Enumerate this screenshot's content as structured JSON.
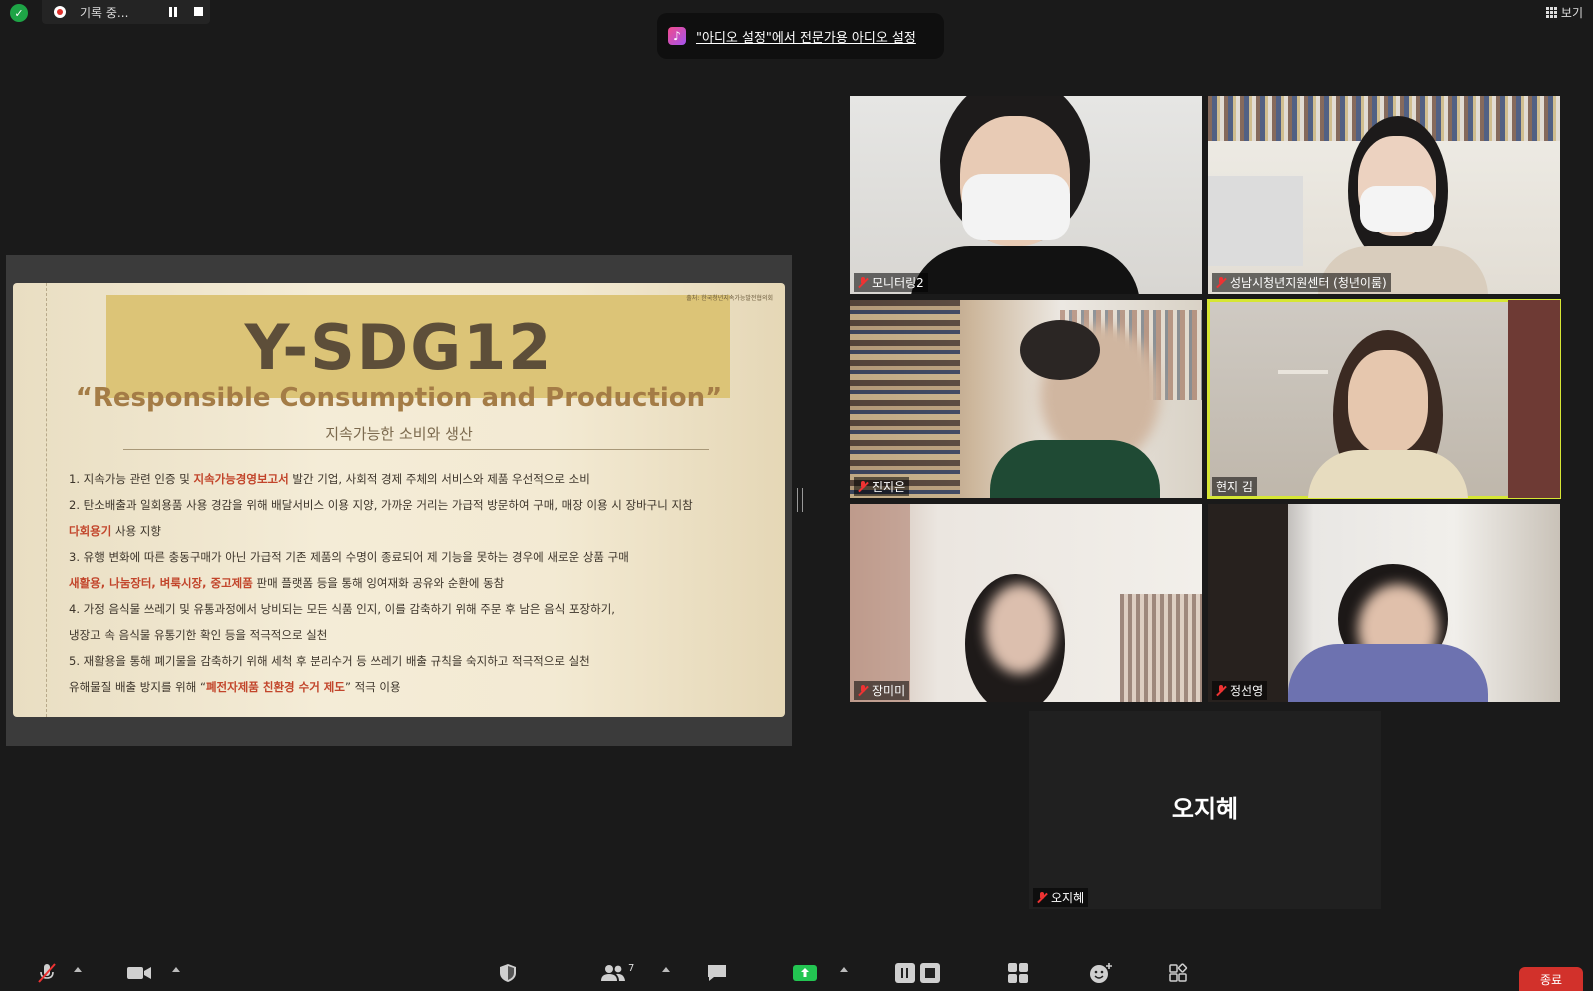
{
  "top_bar": {
    "recording_label": "기록 중...",
    "view_label": "보기"
  },
  "audio_toast": {
    "text": "\"아디오 설정\"에서 전문가용 아디오 설정"
  },
  "slide": {
    "source": "출처: 한국청년지속가능발전협의회",
    "title": "Y-SDG12",
    "subtitle": "“Responsible Consumption and Production”",
    "korean_subtitle": "지속가능한 소비와 생산",
    "lines": [
      {
        "pre": "1. 지속가능 관련 인증 및 ",
        "hl": "지속가능경영보고서",
        "post": " 발간 기업, 사회적 경제 주체의 서비스와 제품 우선적으로 소비"
      },
      {
        "pre": "2. 탄소배출과 일회용품 사용 경감을 위해 배달서비스 이용 지양, 가까운 거리는 가급적 방문하여 구매, 매장 이용 시 장바구니 지참",
        "hl": "",
        "post": ""
      },
      {
        "pre": "",
        "hl": "다회용기",
        "post": " 사용 지향"
      },
      {
        "pre": "3. 유행 변화에 따른 충동구매가 아닌 가급적 기존 제품의 수명이 종료되어 제 기능을 못하는 경우에 새로운 상품 구매",
        "hl": "",
        "post": ""
      },
      {
        "pre": "",
        "hl": "새활용, 나눔장터, 벼룩시장, 중고제품",
        "post": " 판매 플랫폼 등을 통해 잉여재화 공유와 순환에 동참"
      },
      {
        "pre": "4. 가정 음식물 쓰레기 및 유통과정에서 낭비되는 모든 식품 인지, 이를 감축하기 위해 주문 후 남은 음식 포장하기,",
        "hl": "",
        "post": ""
      },
      {
        "pre": "냉장고 속 음식물 유통기한 확인 등을 적극적으로 실천",
        "hl": "",
        "post": ""
      },
      {
        "pre": "5. 재활용을 통해 폐기물을 감축하기 위해 세척 후 분리수거 등 쓰레기 배출 규칙을 숙지하고 적극적으로 실천",
        "hl": "",
        "post": ""
      },
      {
        "pre": "유해물질 배출 방지를 위해 “",
        "hl": "폐전자제품 친환경 수거 제도",
        "post": "” 적극 이용"
      }
    ]
  },
  "participants": [
    {
      "name": "모니터링2",
      "muted": true
    },
    {
      "name": "성남시청년지원센터 (청년이룸)",
      "muted": true
    },
    {
      "name": "진지은",
      "muted": true
    },
    {
      "name": "현지 김",
      "muted": false,
      "active_speaker": true
    },
    {
      "name": "장미미",
      "muted": true
    },
    {
      "name": "정선영",
      "muted": true
    },
    {
      "name": "오지혜",
      "muted": true,
      "video_off": true
    }
  ],
  "toolbar": {
    "participants_count": "7",
    "end_label": "종료"
  },
  "colors": {
    "background": "#1a1a1a",
    "active_speaker": "#d6e634",
    "end_button": "#d2312b",
    "share_green": "#23c552",
    "highlight": "#c2452b"
  }
}
